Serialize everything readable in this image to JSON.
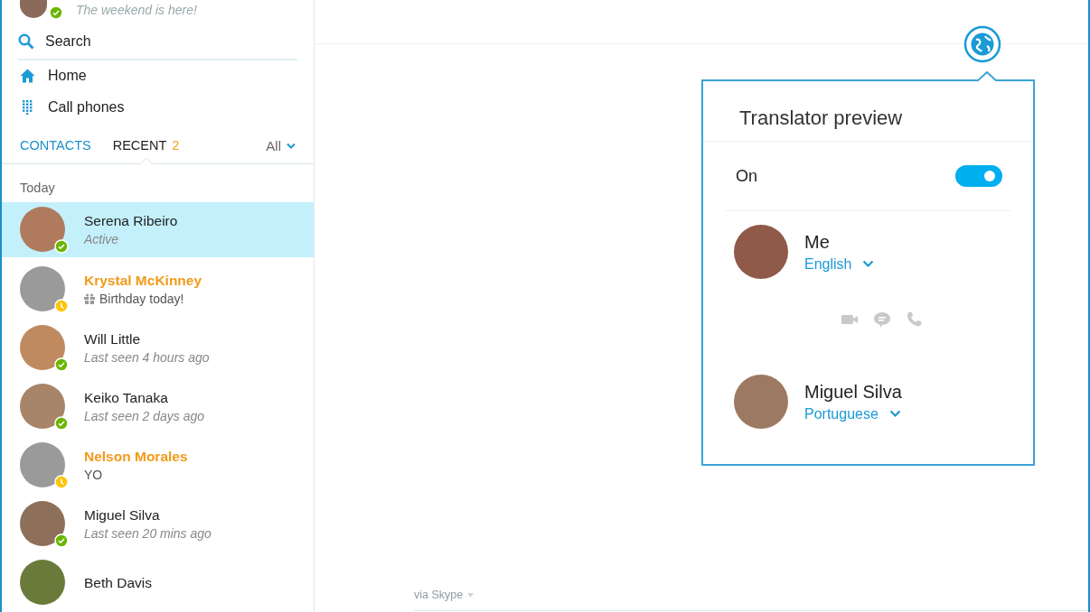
{
  "profile": {
    "mood": "The weekend is here!",
    "away": false
  },
  "search": {
    "placeholder": "Search"
  },
  "nav": [
    {
      "label": "Home",
      "kind": "home"
    },
    {
      "label": "Call phones",
      "kind": "dialpad"
    }
  ],
  "tabs": [
    {
      "label": "CONTACTS",
      "selected": false
    },
    {
      "label": "RECENT",
      "selected": true,
      "count": "2"
    }
  ],
  "filter": {
    "label": "All"
  },
  "section": "Today",
  "contacts": [
    {
      "name": "Serena Ribeiro",
      "subtitle": "Active",
      "kind": "status",
      "away": false,
      "highlighted": false,
      "selected": true
    },
    {
      "name": "Krystal McKinney",
      "subtitle": "Birthday today!",
      "kind": "birthday",
      "away": true,
      "highlighted": true,
      "selected": false
    },
    {
      "name": "Will Little",
      "subtitle": "Last seen 4 hours ago",
      "kind": "status",
      "away": false,
      "highlighted": false,
      "selected": false
    },
    {
      "name": "Keiko Tanaka",
      "subtitle": "Last seen 2 days ago",
      "kind": "status",
      "away": false,
      "highlighted": false,
      "selected": false
    },
    {
      "name": "Nelson Morales",
      "subtitle": "YO",
      "kind": "message",
      "away": true,
      "highlighted": true,
      "selected": false
    },
    {
      "name": "Miguel Silva",
      "subtitle": "Last seen 20 mins ago",
      "kind": "status",
      "away": false,
      "highlighted": false,
      "selected": false
    },
    {
      "name": "Beth Davis",
      "highlighted": false,
      "selected": false
    }
  ],
  "translator": {
    "title": "Translator preview",
    "toggle_label": "On",
    "enabled": true,
    "participants": [
      {
        "name": "Me",
        "language": "English"
      },
      {
        "name": "Miguel Silva",
        "language": "Portuguese"
      }
    ]
  },
  "composer": {
    "via_label": "via Skype"
  }
}
